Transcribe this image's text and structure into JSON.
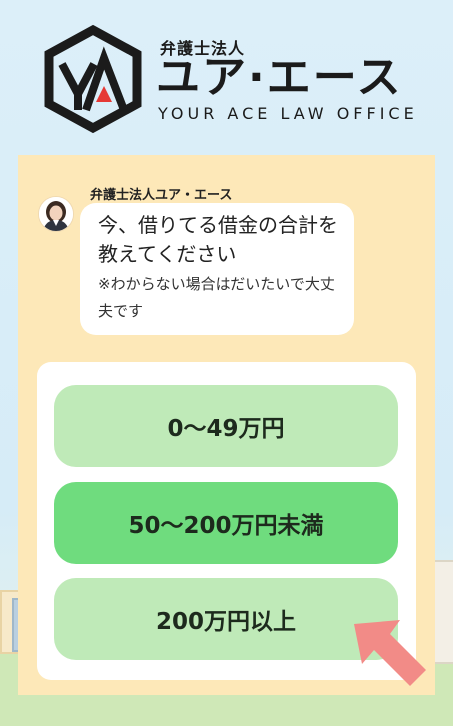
{
  "header": {
    "brand_small": "弁護士法人",
    "brand_big": "ユア·エース",
    "brand_sub": "YOUR ACE LAW OFFICE"
  },
  "chat": {
    "sender": "弁護士法人ユア・エース",
    "message_main": "今、借りてる借金の合計を教えてください",
    "message_note": "※わからない場合はだいたいで大丈夫です"
  },
  "options": [
    {
      "label": "0〜49万円"
    },
    {
      "label": "50〜200万円未満"
    },
    {
      "label": "200万円以上"
    }
  ],
  "colors": {
    "panel": "#fde8b8",
    "option_default": "#bfeab8",
    "option_highlight": "#6fdc7e",
    "arrow": "#f28b87",
    "logo_accent": "#e53935"
  },
  "icons": [
    "logo-icon",
    "avatar",
    "pointer-arrow-icon"
  ]
}
